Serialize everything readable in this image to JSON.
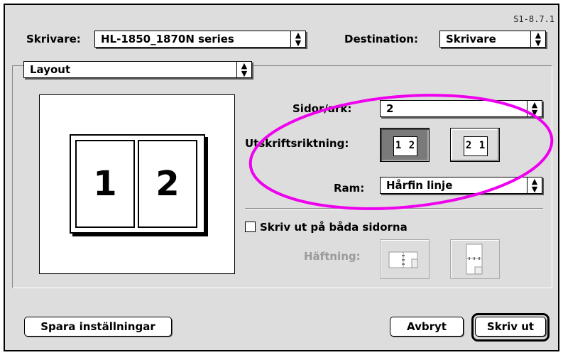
{
  "version": "S1-8.7.1",
  "printer": {
    "label": "Skrivare:",
    "value": "HL-1850_1870N series"
  },
  "destination": {
    "label": "Destination:",
    "value": "Skrivare"
  },
  "panel": {
    "value": "Layout"
  },
  "preview": {
    "pages": [
      "1",
      "2"
    ]
  },
  "pages_per_sheet": {
    "label": "Sidor/ark:",
    "value": "2"
  },
  "orientation": {
    "label": "Utskriftsriktning:",
    "options": [
      {
        "glyph": "1 2",
        "selected": true
      },
      {
        "glyph": "2 1",
        "selected": false
      }
    ]
  },
  "border": {
    "label": "Ram:",
    "value": "Hårfin linje"
  },
  "duplex": {
    "label": "Skriv ut på båda sidorna",
    "checked": false
  },
  "stapling": {
    "label": "Häftning:",
    "enabled": false
  },
  "buttons": {
    "save": "Spara inställningar",
    "cancel": "Avbryt",
    "print": "Skriv ut"
  },
  "colors": {
    "highlight": "#ee00ee",
    "dialog_bg": "#dddddd"
  }
}
